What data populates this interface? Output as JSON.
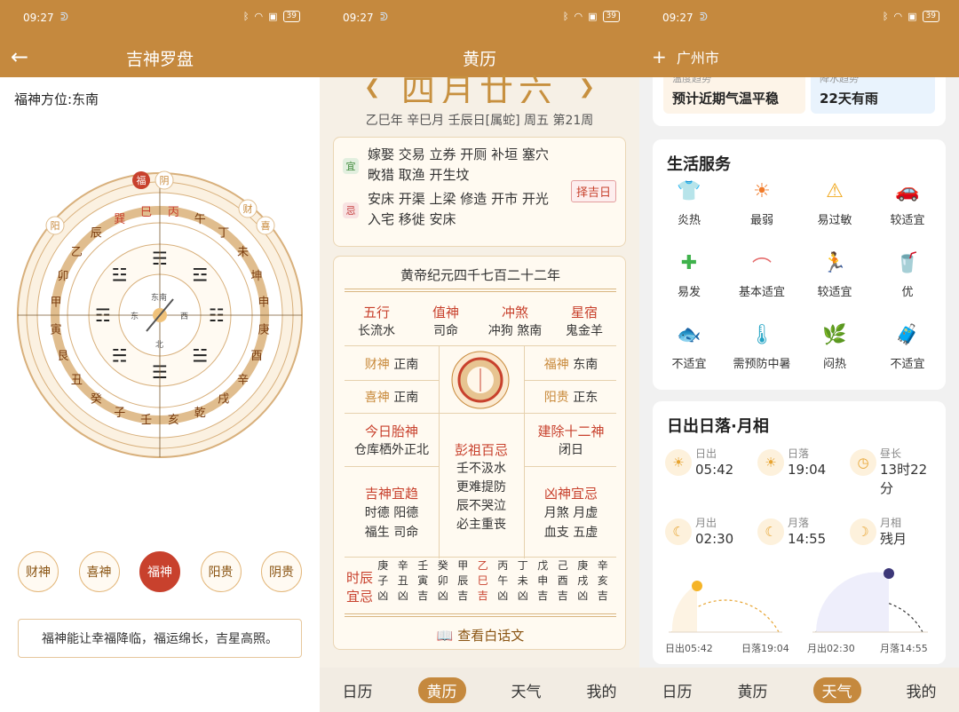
{
  "status": {
    "time": "09:27",
    "battery": "39"
  },
  "screen1": {
    "title": "吉神罗盘",
    "position_label": "福神方位:东南",
    "compass": {
      "top_tags": [
        "福",
        "阴"
      ],
      "side_tags": [
        "阳",
        "财",
        "喜"
      ],
      "ring_labels": [
        "巽",
        "巳",
        "丙",
        "午",
        "丁",
        "未",
        "坤",
        "申",
        "庚",
        "酉",
        "辛",
        "戌",
        "乾",
        "亥",
        "壬",
        "子",
        "癸",
        "丑",
        "艮",
        "寅",
        "甲",
        "卯",
        "乙",
        "辰"
      ],
      "trigrams": [
        "☴",
        "☲",
        "☷",
        "☱",
        "☰",
        "☵",
        "☶",
        "☳"
      ],
      "inner": [
        "东南",
        "东",
        "西",
        "北"
      ]
    },
    "gods": [
      "财神",
      "喜神",
      "福神",
      "阳贵",
      "阴贵"
    ],
    "active_god": "福神",
    "description": "福神能让幸福降临，福运绵长，吉星高照。"
  },
  "screen2": {
    "title": "黄历",
    "big_date": "四月廿六",
    "ganzhi": "乙巳年 辛巳月 壬辰日[属蛇] 周五 第21周",
    "yi_tag": "宜",
    "yi_text": "嫁娶 交易 立券 开厕 补垣 塞穴 畋猎 取渔 开生坟",
    "ji_tag": "忌",
    "ji_text": "安床 开渠 上梁 修造 开市 开光 入宅 移徙 安床",
    "zeji": "择吉日",
    "year_line": "黄帝纪元四千七百二十二年",
    "wuxing": {
      "k": "五行",
      "v": "长流水"
    },
    "zhishen": {
      "k": "值神",
      "v": "司命"
    },
    "chongsha": {
      "k": "冲煞",
      "v": "冲狗 煞南"
    },
    "xingsu": {
      "k": "星宿",
      "v": "鬼金羊"
    },
    "caishen": {
      "k": "财神",
      "v": "正南"
    },
    "fushen": {
      "k": "福神",
      "v": "东南"
    },
    "xishen": {
      "k": "喜神",
      "v": "正南"
    },
    "yanggui": {
      "k": "阳贵",
      "v": "正东"
    },
    "taishen": {
      "k": "今日胎神",
      "v": "仓库栖外正北"
    },
    "pengzu": {
      "k": "彭祖百忌",
      "v1": "壬不汲水",
      "v2": "更难提防",
      "v3": "辰不哭泣",
      "v4": "必主重丧"
    },
    "jianchu": {
      "k": "建除十二神",
      "v": "闭日"
    },
    "jishen": {
      "k": "吉神宜趋",
      "v1": "时德 阳德",
      "v2": "福生 司命"
    },
    "xiongshen": {
      "k": "凶神宜忌",
      "v1": "月煞 月虚",
      "v2": "血支 五虚"
    },
    "shichen_label": [
      "时辰",
      "宜忌"
    ],
    "shichen": [
      {
        "a": "庚",
        "b": "子",
        "c": "凶"
      },
      {
        "a": "辛",
        "b": "丑",
        "c": "凶"
      },
      {
        "a": "壬",
        "b": "寅",
        "c": "吉"
      },
      {
        "a": "癸",
        "b": "卯",
        "c": "凶"
      },
      {
        "a": "甲",
        "b": "辰",
        "c": "吉"
      },
      {
        "a": "乙",
        "b": "巳",
        "c": "吉"
      },
      {
        "a": "丙",
        "b": "午",
        "c": "凶"
      },
      {
        "a": "丁",
        "b": "未",
        "c": "凶"
      },
      {
        "a": "戊",
        "b": "申",
        "c": "吉"
      },
      {
        "a": "己",
        "b": "酉",
        "c": "吉"
      },
      {
        "a": "庚",
        "b": "戌",
        "c": "凶"
      },
      {
        "a": "辛",
        "b": "亥",
        "c": "吉"
      }
    ],
    "view_white": "查看白话文",
    "tabs": [
      "日历",
      "黄历",
      "天气",
      "我的"
    ],
    "active_tab": "黄历"
  },
  "screen3": {
    "city": "广州市",
    "trend_a_small": "温度趋势",
    "trend_a": "预计近期气温平稳",
    "trend_b_small": "降水趋势",
    "trend_b": "22天有雨",
    "services_title": "生活服务",
    "services": [
      {
        "icon": "shirt-icon",
        "label": "炎热"
      },
      {
        "icon": "sun-icon",
        "label": "最弱"
      },
      {
        "icon": "allergy-icon",
        "label": "易过敏"
      },
      {
        "icon": "car-icon",
        "label": "较适宜"
      },
      {
        "icon": "medkit-icon",
        "label": "易发"
      },
      {
        "icon": "hanger-icon",
        "label": "基本适宜"
      },
      {
        "icon": "run-icon",
        "label": "较适宜"
      },
      {
        "icon": "drink-icon",
        "label": "优"
      },
      {
        "icon": "fish-icon",
        "label": "不适宜"
      },
      {
        "icon": "thermometer-icon",
        "label": "需预防中暑"
      },
      {
        "icon": "plant-icon",
        "label": "闷热"
      },
      {
        "icon": "luggage-icon",
        "label": "不适宜"
      }
    ],
    "sun_title": "日出日落·月相",
    "sunrise": {
      "l": "日出",
      "v": "05:42"
    },
    "sunset": {
      "l": "日落",
      "v": "19:04"
    },
    "daylen": {
      "l": "昼长",
      "v": "13时22分"
    },
    "moonrise": {
      "l": "月出",
      "v": "02:30"
    },
    "moonset": {
      "l": "月落",
      "v": "14:55"
    },
    "phase": {
      "l": "月相",
      "v": "残月"
    },
    "arc_sun_left": "日出05:42",
    "arc_sun_right": "日落19:04",
    "arc_moon_left": "月出02:30",
    "arc_moon_right": "月落14:55",
    "tabs": [
      "日历",
      "黄历",
      "天气",
      "我的"
    ],
    "active_tab": "天气"
  }
}
